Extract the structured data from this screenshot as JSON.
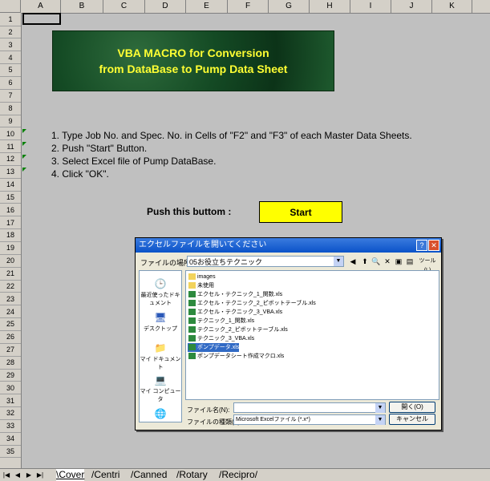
{
  "columns": [
    "A",
    "B",
    "C",
    "D",
    "E",
    "F",
    "G",
    "H",
    "I",
    "J",
    "K"
  ],
  "rows": [
    "1",
    "2",
    "3",
    "4",
    "5",
    "6",
    "7",
    "8",
    "9",
    "10",
    "11",
    "12",
    "13",
    "14",
    "15",
    "16",
    "17",
    "18",
    "19",
    "20",
    "21",
    "22",
    "23",
    "24",
    "25",
    "26",
    "27",
    "28",
    "29",
    "30",
    "31",
    "32",
    "33",
    "34",
    "35"
  ],
  "banner": {
    "line1": "VBA MACRO for Conversion",
    "line2": "from DataBase to Pump Data Sheet"
  },
  "steps": [
    "1. Type Job No. and Spec. No. in Cells of \"F2\" and \"F3\" of each Master Data Sheets.",
    "2. Push \"Start\" Button.",
    "3. Select Excel file of Pump DataBase.",
    "4. Click \"OK\"."
  ],
  "push_label": "Push this buttom  :",
  "start_label": "Start",
  "dialog": {
    "title": "エクセルファイルを開いてください",
    "lookin_label": "ファイルの場所(I):",
    "lookin_value": "05お役立ちテクニック",
    "tools_label": "ツール(L)",
    "places": [
      "最近使ったドキュメント",
      "デスクトップ",
      "マイ ドキュメント",
      "マイ コンピュータ"
    ],
    "files": [
      "images",
      "未使用",
      "エクセル・テクニック_1_関数.xls",
      "エクセル・テクニック_2_ピボットテーブル.xls",
      "エクセル・テクニック_3_VBA.xls",
      "テクニック_1_関数.xls",
      "テクニック_2_ピボットテーブル.xls",
      "テクニック_3_VBA.xls",
      "ポンプデータ.xls",
      "ポンプデータシート作成マクロ.xls"
    ],
    "filename_label": "ファイル名(N):",
    "filetype_label": "ファイルの種類(T):",
    "filetype_value": "Microsoft Excelファイル (*.x*)",
    "open_label": "開く(O)",
    "cancel_label": "キャンセル"
  },
  "tabs": [
    "Cover",
    "Centri",
    "Canned",
    "Rotary",
    "Recipro"
  ],
  "colors": {
    "banner_text": "#ffff33",
    "start_bg": "#ffff00",
    "selection": "#316ac5"
  }
}
